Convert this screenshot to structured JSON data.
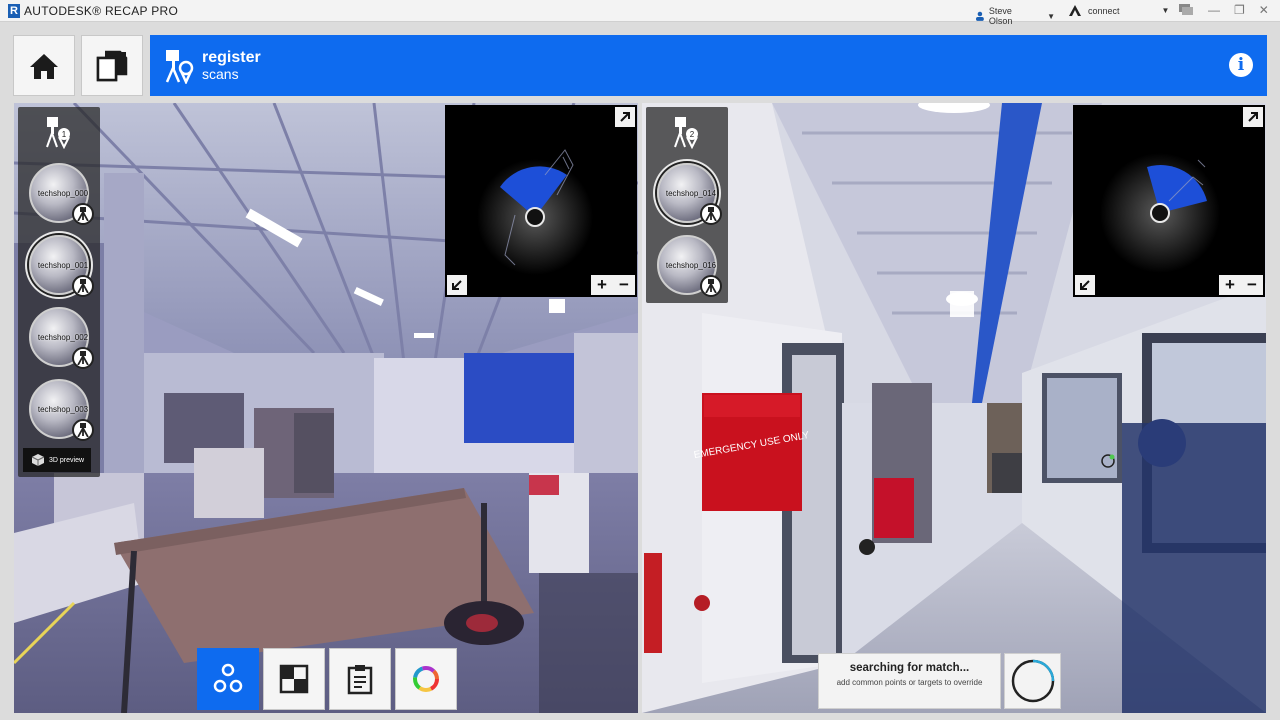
{
  "app": {
    "name": "AUTODESK® RECAP PRO",
    "logo_letter": "R"
  },
  "titlebar": {
    "user": "Steve Olson",
    "connect": "connect"
  },
  "header": {
    "title": "register",
    "subtitle": "scans"
  },
  "left_pane": {
    "group_number": "1",
    "scans": [
      {
        "label": "techshop_000",
        "selected": false
      },
      {
        "label": "techshop_001",
        "selected": true
      },
      {
        "label": "techshop_002",
        "selected": false
      },
      {
        "label": "techshop_003",
        "selected": false
      }
    ],
    "preview_label": "3D preview"
  },
  "right_pane": {
    "group_number": "2",
    "scans": [
      {
        "label": "techshop_014",
        "selected": true
      },
      {
        "label": "techshop_016",
        "selected": false
      }
    ]
  },
  "status": {
    "title": "searching for match...",
    "hint": "add common points or targets to override"
  },
  "colors": {
    "accent": "#0e6bef",
    "tile_bg": "#f5f5f5"
  },
  "icons": {
    "home": "home-icon",
    "pages": "pages-icon",
    "info": "info-icon",
    "register": "register-scans-icon"
  }
}
